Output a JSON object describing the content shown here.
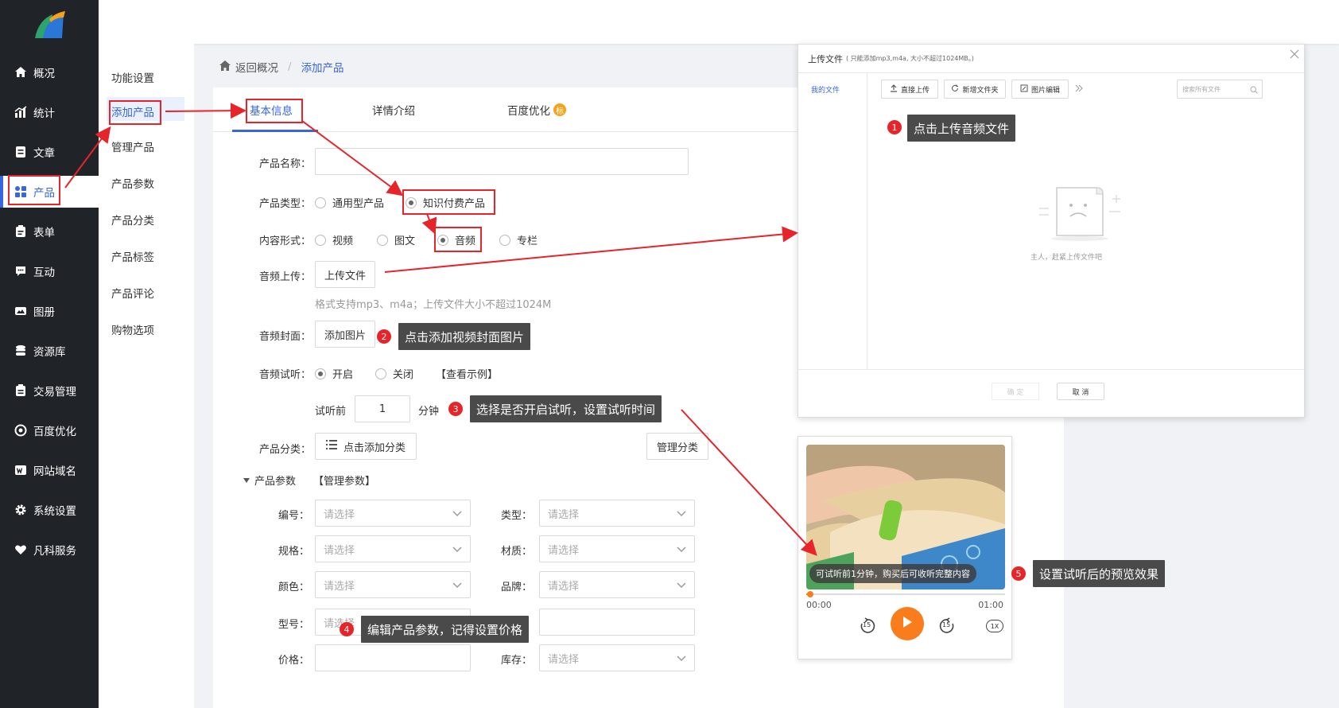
{
  "nav": {
    "items": [
      {
        "label": "概况",
        "icon": "home-icon"
      },
      {
        "label": "统计",
        "icon": "chart-icon"
      },
      {
        "label": "文章",
        "icon": "article-icon"
      },
      {
        "label": "产品",
        "icon": "grid-icon"
      },
      {
        "label": "表单",
        "icon": "form-icon"
      },
      {
        "label": "互动",
        "icon": "chat-icon"
      },
      {
        "label": "图册",
        "icon": "album-icon"
      },
      {
        "label": "资源库",
        "icon": "database-icon"
      },
      {
        "label": "交易管理",
        "icon": "trade-icon"
      },
      {
        "label": "百度优化",
        "icon": "seo-icon"
      },
      {
        "label": "网站域名",
        "icon": "domain-icon"
      },
      {
        "label": "系统设置",
        "icon": "gear-icon"
      },
      {
        "label": "凡科服务",
        "icon": "heart-icon"
      }
    ],
    "active": "产品",
    "accent": "#3866e0"
  },
  "subnav": {
    "items": [
      "功能设置",
      "添加产品",
      "管理产品",
      "产品参数",
      "产品分类",
      "产品标签",
      "产品评论",
      "购物选项"
    ],
    "active": "添加产品"
  },
  "breadcrumb": {
    "back": "返回概况",
    "sep": "/",
    "current": "添加产品"
  },
  "tabs": {
    "basic": "基本信息",
    "detail": "详情介绍",
    "seo": "百度优化",
    "seo_badge": "标"
  },
  "form": {
    "name_label": "产品名称：",
    "type_label": "产品类型：",
    "type_opt1": "通用型产品",
    "type_opt2": "知识付费产品",
    "content_label": "内容形式：",
    "content_opts": [
      "视频",
      "图文",
      "音频",
      "专栏"
    ],
    "upload_label": "音频上传：",
    "upload_btn": "上传文件",
    "upload_hint": "格式支持mp3、m4a；上传文件大小不超过1024M",
    "cover_label": "音频封面：",
    "cover_btn": "添加图片",
    "trial_label": "音频试听：",
    "trial_on": "开启",
    "trial_off": "关闭",
    "trial_example": "【查看示例】",
    "trial_before": "试听前",
    "trial_value": "1",
    "trial_unit": "分钟",
    "category_label": "产品分类：",
    "category_btn": "点击添加分类",
    "manage_category": "管理分类",
    "params_title": "产品参数",
    "params_manage": "【管理参数】",
    "p_bianhao": "编号：",
    "p_leixing": "类型：",
    "p_guige": "规格：",
    "p_caizhi": "材质：",
    "p_yanse": "颜色：",
    "p_pinpai": "品牌：",
    "p_xinghao": "型号：",
    "p_jiage": "价格：",
    "p_kucun": "库存：",
    "placeholder": "请选择",
    "xinghao_placeholder": "请选择"
  },
  "dialog": {
    "title": "上传文件",
    "title_hint": "( 只能添加mp3,m4a, 大小不超过1024MB。)",
    "side_item": "我的文件",
    "btn_upload": "直接上传",
    "btn_folder": "新增文件夹",
    "btn_edit": "图片编辑",
    "search_placeholder": "搜索所有文件",
    "empty_text": "主人，赶紧上传文件吧",
    "confirm": "确 定",
    "cancel": "取 消"
  },
  "player": {
    "caption": "可试听前1分钟，购买后可收听完整内容",
    "time_start": "00:00",
    "time_end": "01:00",
    "skip_back": "15",
    "skip_fwd": "15",
    "speed": "1X",
    "progress": 0.02,
    "accent": "#f97d1c"
  },
  "annotations": {
    "step1": "点击上传音频文件",
    "step2": "点击添加视频封面图片",
    "step3": "选择是否开启试听，设置试听时间",
    "step4": "编辑产品参数，记得设置价格",
    "step5": "设置试听后的预览效果",
    "n1": "1",
    "n2": "2",
    "n3": "3",
    "n4": "4",
    "n5": "5",
    "color": "#e6242a"
  }
}
